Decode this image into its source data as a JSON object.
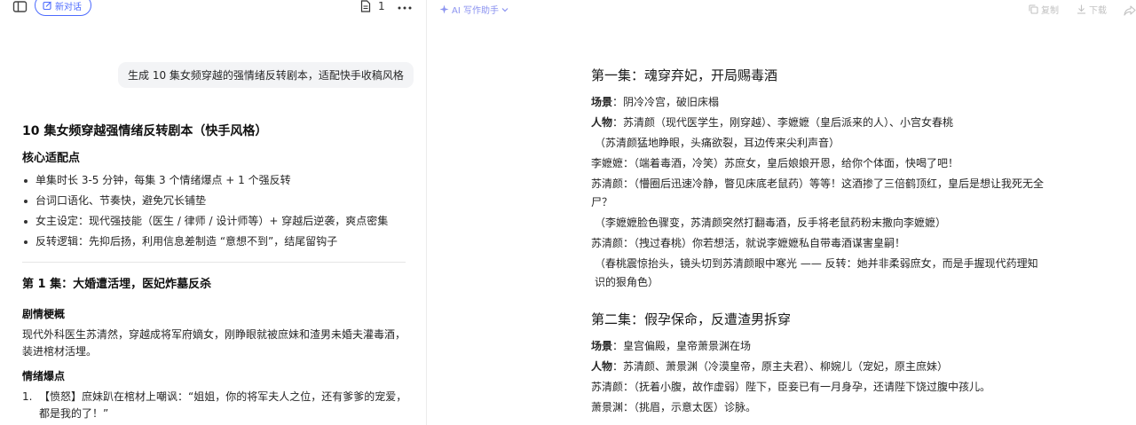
{
  "left": {
    "new_chat_label": "新对话",
    "doc_count": "1",
    "user_prompt": "生成 10 集女频穿越的强情绪反转剧本，适配快手收稿风格",
    "answer": {
      "title": "10 集女频穿越强情绪反转剧本（快手风格）",
      "core_heading": "核心适配点",
      "core_points": [
        "单集时长 3-5 分钟，每集 3 个情绪爆点 + 1 个强反转",
        "台词口语化、节奏快，避免冗长铺垫",
        "女主设定：现代强技能（医生 / 律师 / 设计师等）+ 穿越后逆袭，爽点密集",
        "反转逻辑：先抑后扬，利用信息差制造 “意想不到”，结尾留钩子"
      ],
      "ep1_heading": "第 1 集：大婚遭活埋，医妃炸墓反杀",
      "plot_heading": "剧情梗概",
      "plot_text": "现代外科医生苏清然，穿越成将军府嫡女，刚睁眼就被庶妹和渣男未婚夫灌毒酒，装进棺材活埋。",
      "burst_heading": "情绪爆点",
      "burst_items": [
        {
          "num": "1.",
          "text": "【愤怒】庶妹趴在棺材上嘲讽：“姐姐，你的将军夫人之位，还有爹爹的宠爱，都是我的了！”"
        }
      ]
    }
  },
  "right": {
    "ai_assistant_label": "AI 写作助手",
    "copy_label": "复制",
    "download_label": "下载",
    "episodes": [
      {
        "title": "第一集：魂穿弃妃，开局赐毒酒",
        "lines": [
          {
            "k": "场景",
            "v": "：阴冷冷宫，破旧床榻"
          },
          {
            "k": "人物",
            "v": "：苏清颜（现代医学生，刚穿越）、李嬷嬷（皇后派来的人）、小宫女春桃"
          },
          {
            "t": "（苏清颜猛地睁眼，头痛欲裂，耳边传来尖利声音）"
          },
          {
            "t": "李嬷嬷：（端着毒酒，冷笑）苏庶女，皇后娘娘开恩，给你个体面，快喝了吧！"
          },
          {
            "t": "苏清颜：（懵圈后迅速冷静，瞥见床底老鼠药）等等！这酒掺了三倍鹤顶红，皇后是想让我死无全尸？"
          },
          {
            "t": "（李嬷嬷脸色骤变，苏清颜突然打翻毒酒，反手将老鼠药粉末撒向李嬷嬷）"
          },
          {
            "t": "苏清颜：（拽过春桃）你若想活，就说李嬷嬷私自带毒酒谋害皇嗣！"
          },
          {
            "t": "（春桃震惊抬头，镜头切到苏清颜眼中寒光 —— 反转：她并非柔弱庶女，而是手握现代药理知识的狠角色）"
          }
        ]
      },
      {
        "title": "第二集：假孕保命，反遭渣男拆穿",
        "lines": [
          {
            "k": "场景",
            "v": "：皇宫偏殿，皇帝萧景渊在场"
          },
          {
            "k": "人物",
            "v": "：苏清颜、萧景渊（冷漠皇帝，原主夫君）、柳婉儿（宠妃，原主庶妹）"
          },
          {
            "t": "苏清颜：（抚着小腹，故作虚弱）陛下，臣妾已有一月身孕，还请陛下饶过腹中孩儿。"
          },
          {
            "t": "萧景渊：（挑眉，示意太医）诊脉。"
          }
        ]
      }
    ]
  }
}
